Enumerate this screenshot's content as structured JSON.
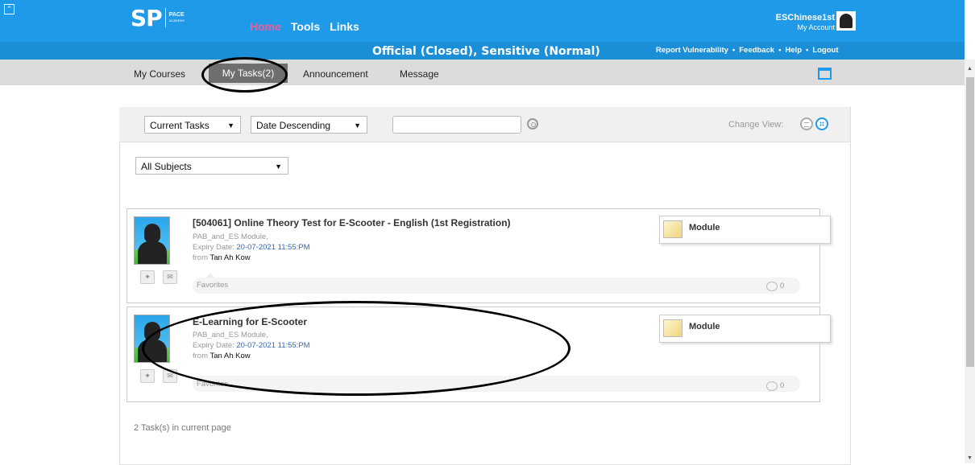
{
  "header": {
    "logo_main": "SP",
    "logo_sub1": "PACE",
    "logo_sub2": "ACADEMY",
    "nav": [
      "Home",
      "Tools",
      "Links"
    ],
    "user_name": "ESChinese1st",
    "my_account": "My Account",
    "classification": "Official (Closed), Sensitive (Normal)",
    "links": [
      "Report Vulnerability",
      "•",
      "Feedback",
      "•",
      "Help",
      "•",
      "Logout"
    ]
  },
  "tabs": {
    "my_courses": "My Courses",
    "my_tasks": "My Tasks(2)",
    "announcement": "Announcement",
    "message": "Message"
  },
  "filters": {
    "status": "Current Tasks",
    "sort": "Date Descending",
    "search_value": "",
    "change_view": "Change View:",
    "subject": "All Subjects"
  },
  "tasks": [
    {
      "title": "[504061] Online Theory Test for E-Scooter - English (1st Registration)",
      "module": "PAB_and_ES Module,",
      "expiry_label": "Expiry Date:",
      "expiry": "20-07-2021 11:55:PM",
      "from_label": "from",
      "from": "Tan Ah Kow",
      "favorites": "Favorites",
      "comments": "0",
      "type": "Module"
    },
    {
      "title": "E-Learning for E-Scooter",
      "module": "PAB_and_ES Module,",
      "expiry_label": "Expiry Date:",
      "expiry": "20-07-2021 11:55:PM",
      "from_label": "from",
      "from": "Tan Ah Kow",
      "favorites": "Favorites",
      "comments": "0",
      "type": "Module"
    }
  ],
  "footer": {
    "count_text": "2 Task(s) in current page"
  },
  "icons": {
    "collapse": "double-chevron-up-icon",
    "calendar": "calendar-icon",
    "search": "search-icon",
    "pin": "pin-icon",
    "mail": "mail-icon",
    "comment": "comment-icon"
  },
  "colors": {
    "header_blue": "#1e9ae8",
    "home_pink": "#e8609a",
    "tab_active": "#6f6f6f"
  }
}
